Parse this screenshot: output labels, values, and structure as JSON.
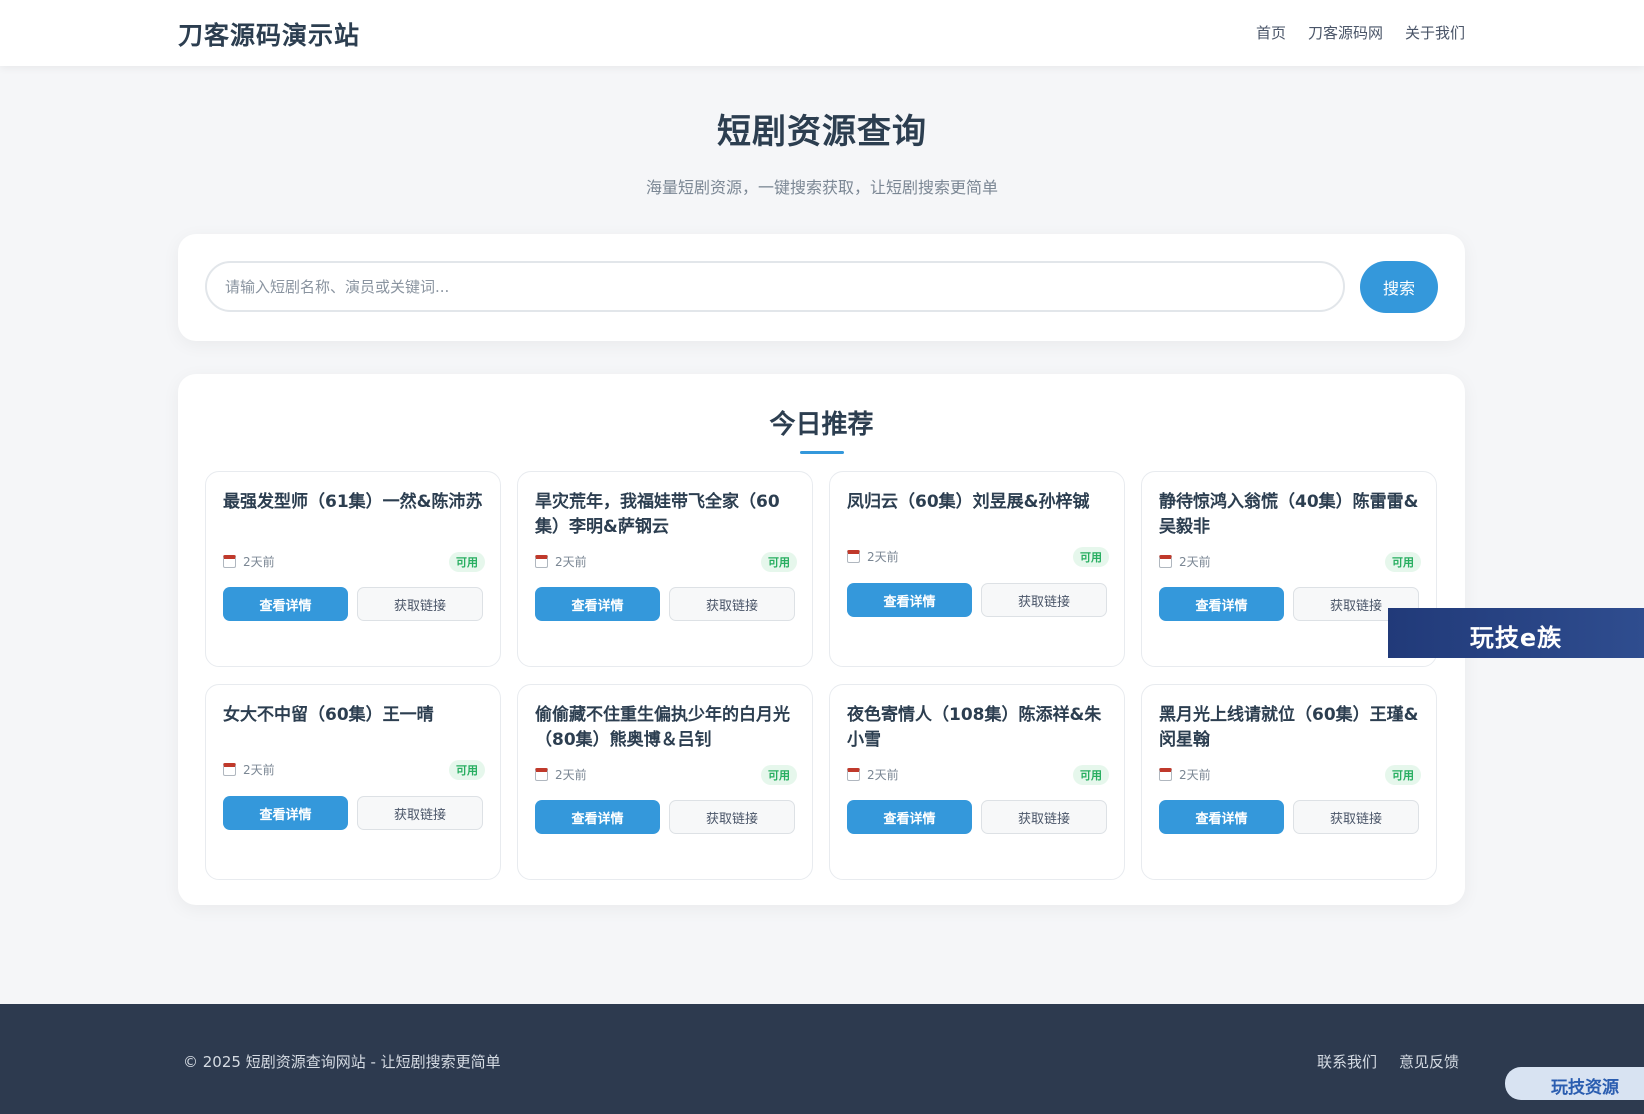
{
  "header": {
    "brand": "刀客源码演示站",
    "nav": [
      "首页",
      "刀客源码网",
      "关于我们"
    ]
  },
  "hero": {
    "title": "短剧资源查询",
    "subtitle": "海量短剧资源，一键搜索获取，让短剧搜索更简单"
  },
  "search": {
    "placeholder": "请输入短剧名称、演员或关键词...",
    "button": "搜索"
  },
  "recommend": {
    "title": "今日推荐",
    "items": [
      {
        "title": "最强发型师（61集）一然&陈沛苏",
        "date": "2天前",
        "status": "可用",
        "detail": "查看详情",
        "link": "获取链接"
      },
      {
        "title": "旱灾荒年，我福娃带飞全家（60集）李明&萨钢云",
        "date": "2天前",
        "status": "可用",
        "detail": "查看详情",
        "link": "获取链接"
      },
      {
        "title": "凤归云（60集）刘昱展&孙梓铖",
        "date": "2天前",
        "status": "可用",
        "detail": "查看详情",
        "link": "获取链接"
      },
      {
        "title": "静待惊鸿入翁慌（40集）陈雷雷&吴毅非",
        "date": "2天前",
        "status": "可用",
        "detail": "查看详情",
        "link": "获取链接"
      },
      {
        "title": "女大不中留（60集）王一晴",
        "date": "2天前",
        "status": "可用",
        "detail": "查看详情",
        "link": "获取链接"
      },
      {
        "title": "偷偷藏不住重生偏执少年的白月光（80集）熊奥博＆吕钊",
        "date": "2天前",
        "status": "可用",
        "detail": "查看详情",
        "link": "获取链接"
      },
      {
        "title": "夜色寄情人（108集）陈添祥&朱小雪",
        "date": "2天前",
        "status": "可用",
        "detail": "查看详情",
        "link": "获取链接"
      },
      {
        "title": "黑月光上线请就位（60集）王瑾&闵星翰",
        "date": "2天前",
        "status": "可用",
        "detail": "查看详情",
        "link": "获取链接"
      }
    ]
  },
  "footer": {
    "copyright": "© 2025 短剧资源查询网站 - 让短剧搜索更简单",
    "links": [
      "联系我们",
      "意见反馈"
    ]
  },
  "watermarks": {
    "banner": "玩技e族",
    "pill": "玩技资源"
  }
}
